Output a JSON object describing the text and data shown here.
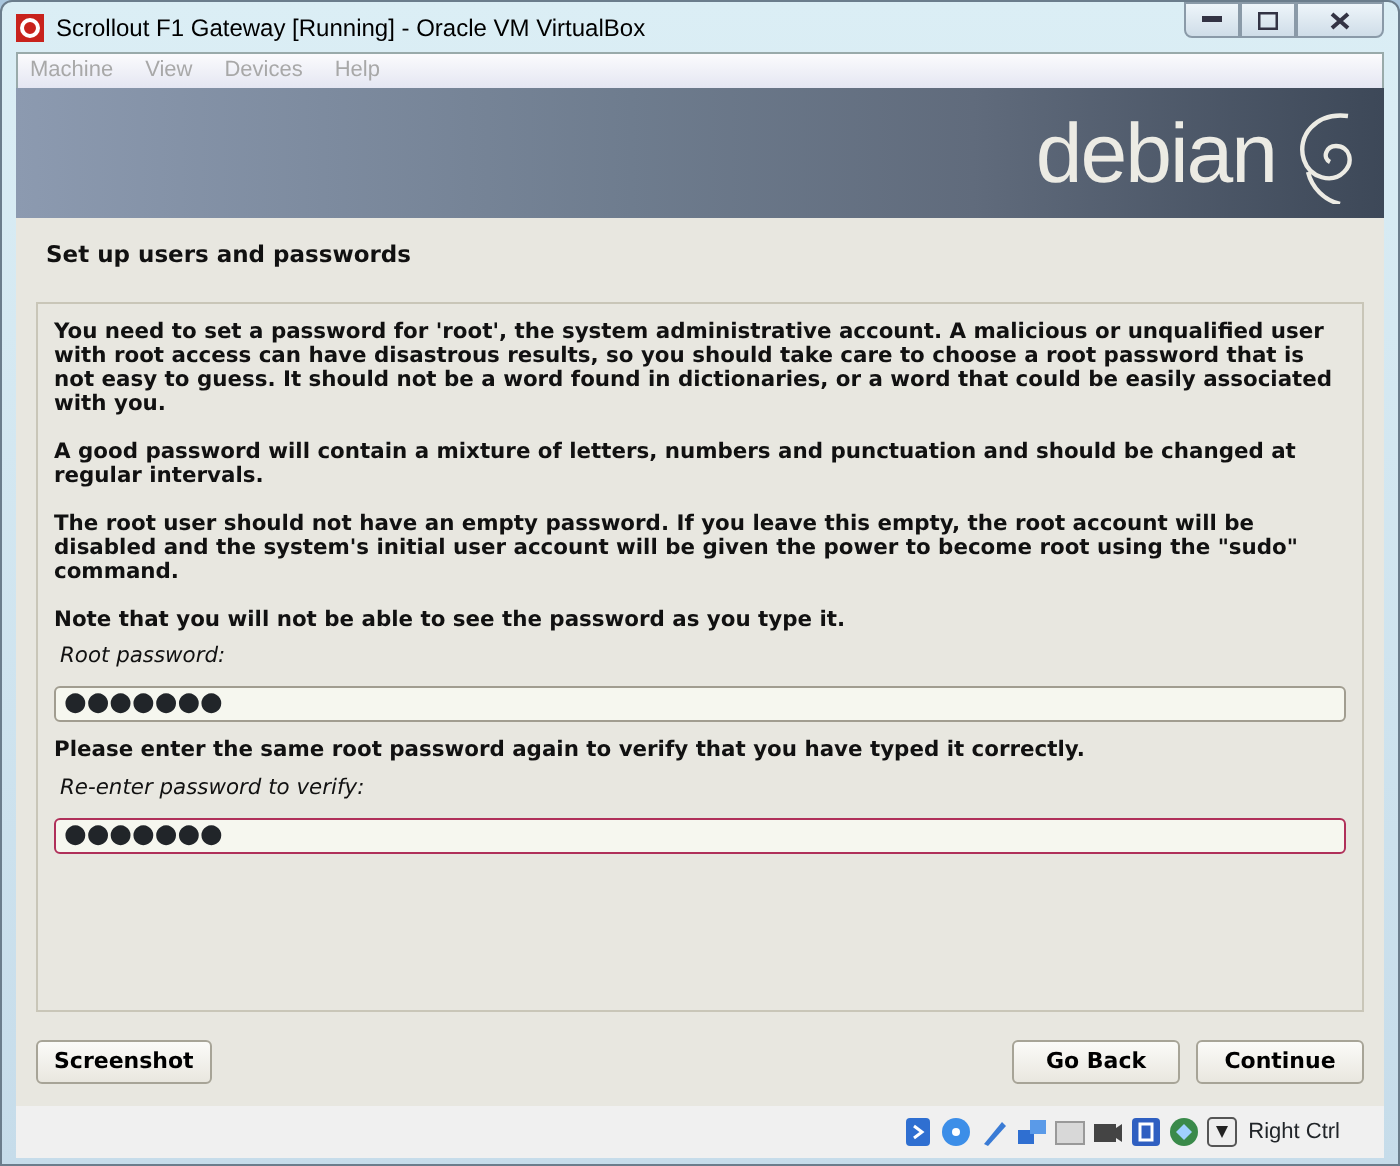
{
  "window": {
    "title": "Scrollout F1 Gateway [Running] - Oracle VM VirtualBox"
  },
  "menu": [
    {
      "label": "Machine",
      "disabled": true
    },
    {
      "label": "View",
      "disabled": true
    },
    {
      "label": "Devices",
      "disabled": true
    },
    {
      "label": "Help",
      "disabled": true
    }
  ],
  "banner": {
    "logo_text": "debian"
  },
  "installer": {
    "heading": "Set up users and passwords",
    "paragraphs": [
      "You need to set a password for 'root', the system administrative account. A malicious or unqualified user with root access can have disastrous results, so you should take care to choose a root password that is not easy to guess. It should not be a word found in dictionaries, or a word that could be easily associated with you.",
      "A good password will contain a mixture of letters, numbers and punctuation and should be changed at regular intervals.",
      "The root user should not have an empty password. If you leave this empty, the root account will be disabled and the system's initial user account will be given the power to become root using the \"sudo\" command.",
      "Note that you will not be able to see the password as you type it."
    ],
    "fields": [
      {
        "label": "Root password:",
        "value": "●●●●●●●",
        "focused": false
      },
      {
        "intro": "Please enter the same root password again to verify that you have typed it correctly.",
        "label": "Re-enter password to verify:",
        "value": "●●●●●●●",
        "focused": true
      }
    ]
  },
  "buttons": {
    "left": [
      "Screenshot"
    ],
    "right": [
      "Go Back",
      "Continue"
    ]
  },
  "status_bar": {
    "host_key": "Right Ctrl"
  }
}
